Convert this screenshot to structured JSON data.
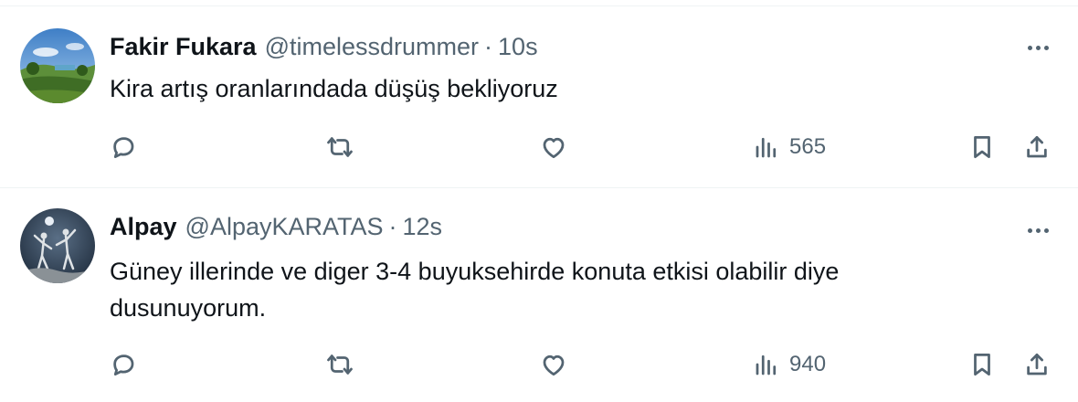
{
  "tweets": [
    {
      "display_name": "Fakir Fukara",
      "handle": "@timelessdrummer",
      "separator": "·",
      "time": "10s",
      "text": "Kira artış oranlarındada düşüş bekliyoruz",
      "views": "565",
      "avatar": "landscape-avatar"
    },
    {
      "display_name": "Alpay",
      "handle": "@AlpayKARATAS",
      "separator": "·",
      "time": "12s",
      "text": "Güney illerinde ve diger 3-4 buyuksehirde konuta etkisi olabilir diye dusunuyorum.",
      "views": "940",
      "avatar": "statue-avatar"
    }
  ],
  "icons": {
    "reply": "reply-icon",
    "retweet": "retweet-icon",
    "like": "heart-icon",
    "views": "views-icon",
    "bookmark": "bookmark-icon",
    "share": "share-icon",
    "more": "more-icon"
  },
  "colors": {
    "text": "#0f1419",
    "secondary": "#536471",
    "divider": "#eff3f4"
  }
}
